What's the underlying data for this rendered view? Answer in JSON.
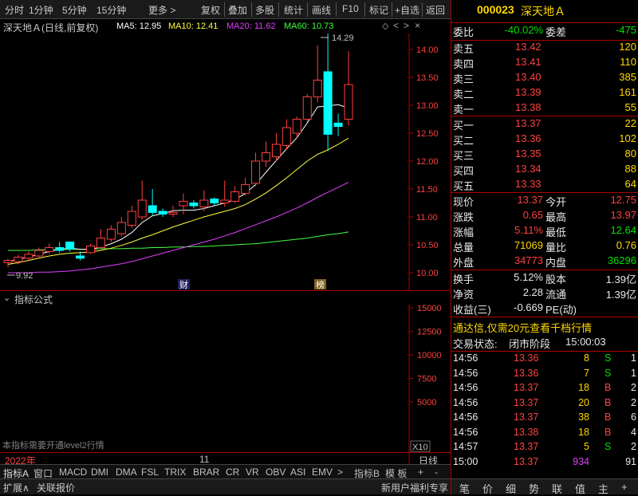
{
  "toolbar": {
    "items": [
      "分时",
      "1分钟",
      "5分钟",
      "15分钟",
      "更多 >",
      "复权",
      "叠加",
      "多股",
      "统计",
      "画线",
      "F10",
      "标记",
      "+自选",
      "返回"
    ]
  },
  "title": {
    "stock": "深天地Ａ(日线,前复权)",
    "ma5": "MA5: 12.95",
    "ma10": "MA10: 12.41",
    "ma20": "MA20: 11.62",
    "ma60": "MA60: 10.73"
  },
  "price_axis": [
    "14.00",
    "13.50",
    "13.00",
    "12.50",
    "12.00",
    "11.50",
    "11.00",
    "10.50",
    "10.00"
  ],
  "annotations": {
    "high": "14.29",
    "low": "9.92",
    "mark_cai": "财",
    "mark_bang": "榜"
  },
  "indicator": {
    "header": "指标公式",
    "axis": [
      "15000",
      "12500",
      "10000",
      "7500",
      "5000"
    ],
    "note": "本指标需要开通level2行情",
    "scale": "X10"
  },
  "dates": {
    "year": "2022年",
    "month": "11",
    "period": "日线"
  },
  "bottom_tabs": [
    "指标A",
    "窗口",
    "MACD",
    "DMI",
    "DMA",
    "FSL",
    "TRIX",
    "BRAR",
    "CR",
    "VR",
    "OBV",
    "ASI",
    "EMV",
    ">",
    "指标B",
    "模 板",
    "+",
    "-"
  ],
  "status": {
    "left1": "扩展∧",
    "left2": "关联报价",
    "right": "新用户福利专享"
  },
  "quote": {
    "code": "000023",
    "name": "深天地Ａ",
    "weibi_label": "委比",
    "weibi": "-40.02%",
    "weicha_label": "委差",
    "weicha": "-475",
    "asks": [
      {
        "label": "卖五",
        "price": "13.42",
        "vol": "120"
      },
      {
        "label": "卖四",
        "price": "13.41",
        "vol": "110"
      },
      {
        "label": "卖三",
        "price": "13.40",
        "vol": "385"
      },
      {
        "label": "卖二",
        "price": "13.39",
        "vol": "161"
      },
      {
        "label": "卖一",
        "price": "13.38",
        "vol": "55"
      }
    ],
    "bids": [
      {
        "label": "买一",
        "price": "13.37",
        "vol": "22"
      },
      {
        "label": "买二",
        "price": "13.36",
        "vol": "102"
      },
      {
        "label": "买三",
        "price": "13.35",
        "vol": "80"
      },
      {
        "label": "买四",
        "price": "13.34",
        "vol": "88"
      },
      {
        "label": "买五",
        "price": "13.33",
        "vol": "64"
      }
    ],
    "stats": [
      {
        "l1": "现价",
        "v1": "13.37",
        "l2": "今开",
        "v2": "12.75"
      },
      {
        "l1": "涨跌",
        "v1": "0.65",
        "l2": "最高",
        "v2": "13.97"
      },
      {
        "l1": "涨幅",
        "v1": "5.11%",
        "l2": "最低",
        "v2": "12.64"
      },
      {
        "l1": "总量",
        "v1": "71069",
        "l2": "量比",
        "v2": "0.76"
      },
      {
        "l1": "外盘",
        "v1": "34773",
        "l2": "内盘",
        "v2": "36296"
      }
    ],
    "fin": [
      {
        "l1": "换手",
        "v1": "5.12%",
        "l2": "股本",
        "v2": "1.39亿"
      },
      {
        "l1": "净资",
        "v1": "2.28",
        "l2": "流通",
        "v2": "1.39亿"
      },
      {
        "l1": "收益(三)",
        "v1": "-0.669",
        "l2": "PE(动)",
        "v2": ""
      }
    ],
    "ad": "通达信,仅需20元查看千档行情",
    "trade_state_label": "交易状态:",
    "trade_state": "闭市阶段",
    "trade_time": "15:00:03"
  },
  "trades": [
    {
      "t": "14:56",
      "p": "13.36",
      "v": "8",
      "bs": "S",
      "n": "1"
    },
    {
      "t": "14:56",
      "p": "13.36",
      "v": "7",
      "bs": "S",
      "n": "1"
    },
    {
      "t": "14:56",
      "p": "13.37",
      "v": "18",
      "bs": "B",
      "n": "2"
    },
    {
      "t": "14:56",
      "p": "13.37",
      "v": "20",
      "bs": "B",
      "n": "2"
    },
    {
      "t": "14:56",
      "p": "13.37",
      "v": "38",
      "bs": "B",
      "n": "6"
    },
    {
      "t": "14:56",
      "p": "13.38",
      "v": "18",
      "bs": "B",
      "n": "4"
    },
    {
      "t": "14:57",
      "p": "13.37",
      "v": "5",
      "bs": "S",
      "n": "2"
    },
    {
      "t": "15:00",
      "p": "13.37",
      "v": "934",
      "bs": "",
      "n": "91"
    }
  ],
  "right_tabs": [
    "笔",
    "价",
    "细",
    "势",
    "联",
    "值",
    "主",
    "+"
  ],
  "chart_data": {
    "type": "candlestick",
    "ylim": [
      9.85,
      14.3
    ],
    "candles": [
      [
        10.18,
        10.22,
        10.1,
        10.25
      ],
      [
        10.2,
        10.28,
        10.15,
        10.32
      ],
      [
        10.26,
        10.33,
        10.22,
        10.38
      ],
      [
        10.3,
        10.4,
        10.26,
        10.45
      ],
      [
        10.38,
        10.45,
        10.34,
        10.52
      ],
      [
        10.45,
        10.4,
        10.36,
        10.55
      ],
      [
        10.55,
        10.42,
        10.38,
        10.56
      ],
      [
        10.3,
        10.26,
        10.22,
        10.38
      ],
      [
        10.36,
        10.48,
        10.34,
        10.52
      ],
      [
        10.45,
        10.62,
        10.42,
        10.78
      ],
      [
        10.6,
        10.78,
        10.55,
        10.85
      ],
      [
        10.7,
        10.9,
        10.65,
        11.0
      ],
      [
        10.85,
        11.1,
        10.8,
        11.2
      ],
      [
        11.0,
        11.3,
        10.95,
        11.65
      ],
      [
        11.2,
        11.08,
        11.02,
        11.5
      ],
      [
        11.1,
        11.05,
        11.0,
        11.15
      ],
      [
        11.05,
        11.08,
        11.0,
        11.2
      ],
      [
        11.2,
        11.28,
        11.05,
        11.42
      ],
      [
        11.25,
        11.2,
        11.15,
        11.3
      ],
      [
        11.18,
        11.3,
        11.1,
        11.48
      ],
      [
        11.32,
        11.25,
        11.2,
        11.35
      ],
      [
        11.25,
        11.3,
        11.18,
        11.65
      ],
      [
        11.28,
        11.45,
        11.25,
        11.55
      ],
      [
        11.42,
        11.58,
        11.38,
        11.7
      ],
      [
        11.6,
        12.0,
        11.55,
        12.15
      ],
      [
        12.0,
        12.15,
        11.9,
        12.35
      ],
      [
        12.08,
        12.3,
        12.0,
        12.5
      ],
      [
        12.28,
        12.6,
        12.2,
        12.75
      ],
      [
        12.5,
        12.75,
        12.4,
        12.8
      ],
      [
        12.75,
        13.15,
        12.7,
        13.2
      ],
      [
        13.15,
        13.45,
        13.05,
        14.07
      ],
      [
        13.6,
        12.48,
        12.18,
        14.29
      ],
      [
        12.68,
        12.62,
        12.45,
        12.85
      ],
      [
        12.75,
        13.37,
        12.64,
        13.97
      ]
    ],
    "ma5": [
      10.2,
      10.24,
      10.28,
      10.33,
      10.38,
      10.42,
      10.44,
      10.42,
      10.42,
      10.46,
      10.52,
      10.6,
      10.72,
      10.9,
      11.02,
      11.06,
      11.11,
      11.12,
      11.12,
      11.15,
      11.2,
      11.25,
      11.31,
      11.42,
      11.58,
      11.8,
      12.01,
      12.22,
      12.42,
      12.68,
      12.97,
      12.99,
      13.01,
      12.95
    ],
    "ma10": [
      10.15,
      10.18,
      10.22,
      10.26,
      10.3,
      10.33,
      10.35,
      10.36,
      10.37,
      10.4,
      10.44,
      10.49,
      10.55,
      10.62,
      10.68,
      10.75,
      10.82,
      10.88,
      10.94,
      11.0,
      11.05,
      11.1,
      11.15,
      11.22,
      11.32,
      11.43,
      11.56,
      11.7,
      11.85,
      12.0,
      12.12,
      12.2,
      12.3,
      12.41
    ],
    "ma20": [
      10.0,
      10.0,
      10.0,
      10.01,
      10.01,
      10.02,
      10.03,
      10.05,
      10.07,
      10.1,
      10.13,
      10.16,
      10.2,
      10.25,
      10.3,
      10.35,
      10.4,
      10.45,
      10.5,
      10.55,
      10.6,
      10.66,
      10.72,
      10.79,
      10.86,
      10.93,
      11.0,
      11.08,
      11.16,
      11.25,
      11.35,
      11.44,
      11.53,
      11.62
    ],
    "ma60": [
      10.4,
      10.4,
      10.4,
      10.41,
      10.41,
      10.41,
      10.42,
      10.42,
      10.42,
      10.43,
      10.43,
      10.43,
      10.44,
      10.44,
      10.45,
      10.45,
      10.46,
      10.46,
      10.47,
      10.47,
      10.48,
      10.49,
      10.5,
      10.51,
      10.52,
      10.54,
      10.56,
      10.58,
      10.6,
      10.62,
      10.65,
      10.68,
      10.7,
      10.73
    ],
    "colors": {
      "up": "#ff4040",
      "down": "#00ffff",
      "ma5": "#ffffff",
      "ma10": "#ffff40",
      "ma20": "#e040ff",
      "ma60": "#40ff40"
    }
  }
}
